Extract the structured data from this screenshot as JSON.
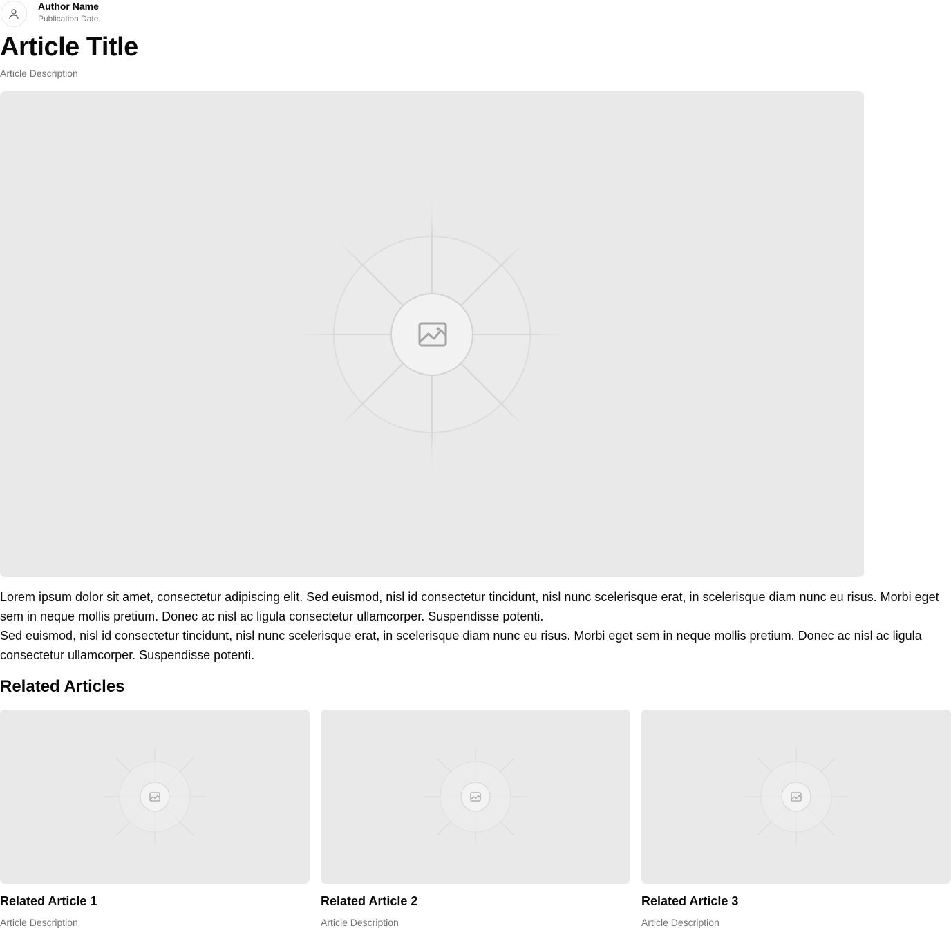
{
  "author": {
    "name": "Author Name",
    "date": "Publication Date",
    "avatar_icon": "user-icon"
  },
  "article": {
    "title": "Article Title",
    "description": "Article Description",
    "hero_icon": "image-placeholder-icon",
    "paragraphs": [
      "Lorem ipsum dolor sit amet, consectetur adipiscing elit. Sed euismod, nisl id consectetur tincidunt, nisl nunc scelerisque erat, in scelerisque diam nunc eu risus. Morbi eget sem in neque mollis pretium. Donec ac nisl ac ligula consectetur ullamcorper. Suspendisse potenti.",
      "Sed euismod, nisl id consectetur tincidunt, nisl nunc scelerisque erat, in scelerisque diam nunc eu risus. Morbi eget sem in neque mollis pretium. Donec ac nisl ac ligula consectetur ullamcorper. Suspendisse potenti."
    ]
  },
  "related": {
    "heading": "Related Articles",
    "items": [
      {
        "title": "Related Article 1",
        "description": "Article Description"
      },
      {
        "title": "Related Article 2",
        "description": "Article Description"
      },
      {
        "title": "Related Article 3",
        "description": "Article Description"
      }
    ]
  },
  "colors": {
    "placeholder_bg": "#e9e9e9",
    "muted_text": "#737373",
    "text": "#0a0a0a"
  }
}
